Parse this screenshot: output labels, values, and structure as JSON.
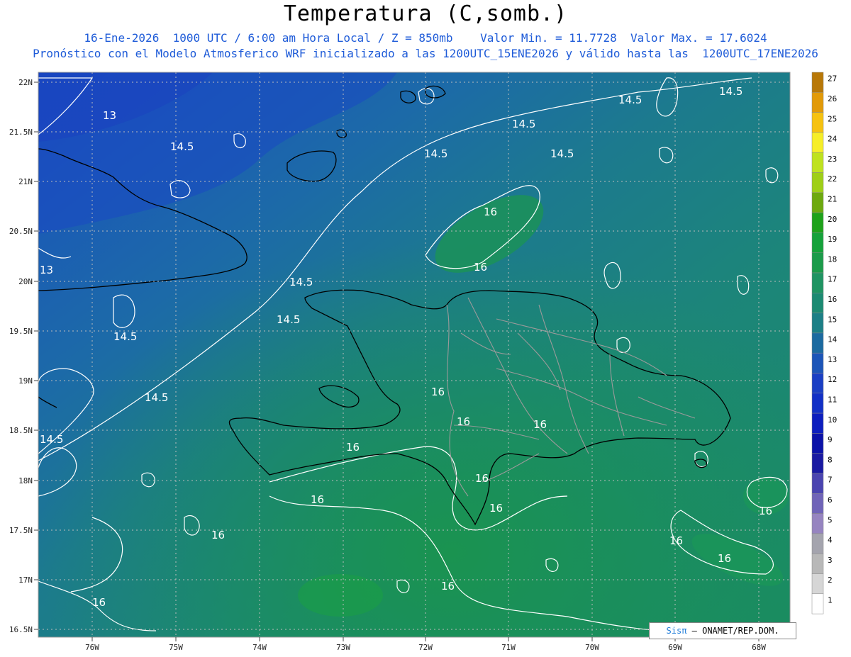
{
  "title": "Temperatura (C,somb.)",
  "subtitle1": "16-Ene-2026  1000 UTC / 6:00 am Hora Local / Z = 850mb    Valor Min. = 11.7728  Valor Max. = 17.6024",
  "subtitle2": "Pronóstico con el Modelo Atmosferico WRF inicializado a las 1200UTC_15ENE2026 y válido hasta las  1200UTC_17ENE2026",
  "lat_labels": [
    "22N",
    "21.5N",
    "21N",
    "20.5N",
    "20N",
    "19.5N",
    "19N",
    "18.5N",
    "18N",
    "17.5N",
    "17N",
    "16.5N"
  ],
  "lon_labels": [
    "76W",
    "75W",
    "74W",
    "73W",
    "72W",
    "71W",
    "70W",
    "69W",
    "68W"
  ],
  "contour_labels": [
    "13",
    "14.5",
    "14.5",
    "14.5",
    "13",
    "14.5",
    "14.5",
    "14.5",
    "14.5",
    "14.5",
    "14.5",
    "16",
    "16",
    "16",
    "16",
    "16",
    "16",
    "16",
    "16",
    "16",
    "16",
    "16",
    "16",
    "16",
    "16"
  ],
  "colorbar": {
    "levels": [
      "27",
      "26",
      "25",
      "24",
      "23",
      "22",
      "21",
      "20",
      "19",
      "18",
      "17",
      "16",
      "15",
      "14",
      "13",
      "12",
      "11",
      "10",
      "9",
      "8",
      "7",
      "6",
      "5",
      "4",
      "3",
      "2",
      "1"
    ],
    "colors": [
      "#b87808",
      "#e29a08",
      "#f6c210",
      "#f6ee28",
      "#bfe21f",
      "#9fcf17",
      "#6da90f",
      "#1ea21a",
      "#15a23a",
      "#1b9b4a",
      "#1f9462",
      "#1c8a72",
      "#1c7f86",
      "#1c6aa0",
      "#1c55b8",
      "#1a3fc4",
      "#1230c6",
      "#0d1ebe",
      "#0b12a8",
      "#1a1aa2",
      "#4a44b0",
      "#7064b8",
      "#9684c0",
      "#a4a4ae",
      "#b8b8b8",
      "#d6d6d6",
      "#ffffff"
    ]
  },
  "credit": {
    "brand": "Sisπ",
    "text": "– ONAMET/REP.DOM."
  }
}
